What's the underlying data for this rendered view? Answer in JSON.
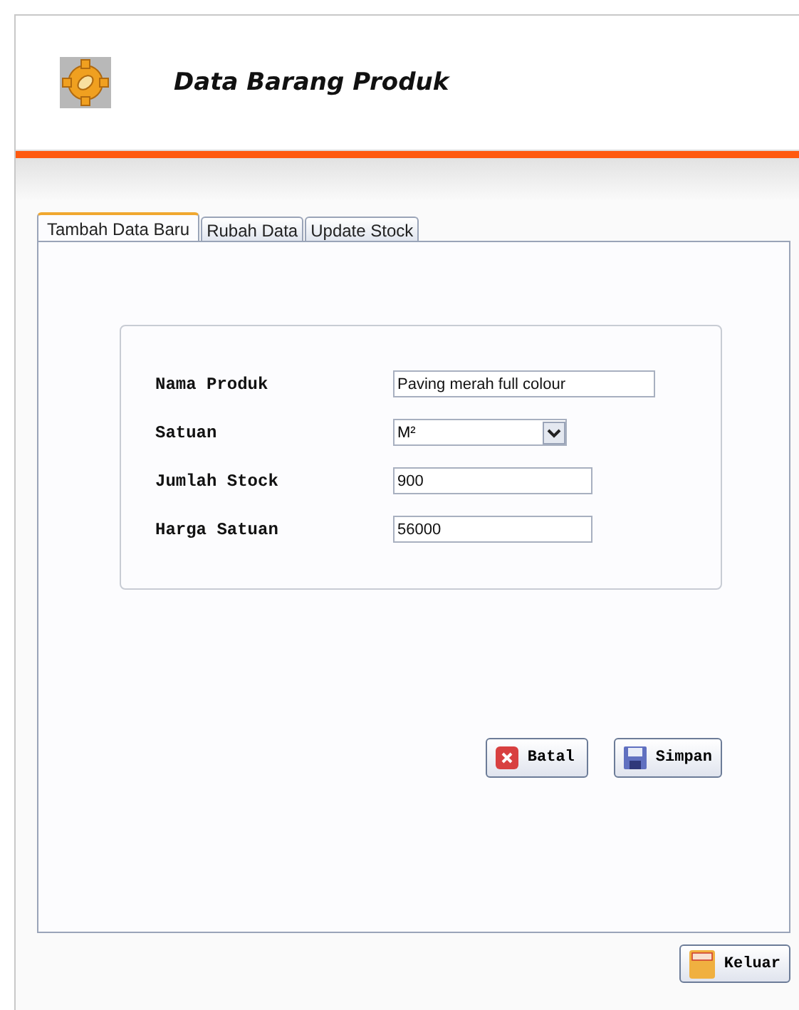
{
  "window": {
    "title": "Data Barang Produk"
  },
  "tabs": [
    {
      "label": "Tambah Data Baru",
      "selected": true
    },
    {
      "label": "Rubah Data",
      "selected": false
    },
    {
      "label": "Update Stock",
      "selected": false
    }
  ],
  "form": {
    "fields": [
      {
        "kind": "text",
        "label": "Nama Produk",
        "value": "Paving merah full colour"
      },
      {
        "kind": "select",
        "label": "Satuan",
        "value": "M²"
      },
      {
        "kind": "text",
        "label": "Jumlah Stock",
        "value": "900"
      },
      {
        "kind": "text",
        "label": "Harga Satuan",
        "value": "56000"
      }
    ]
  },
  "buttons": [
    {
      "kind": "cancel",
      "label": "Batal"
    },
    {
      "kind": "save",
      "label": "Simpan"
    }
  ],
  "exit_button": {
    "label": "Keluar"
  }
}
